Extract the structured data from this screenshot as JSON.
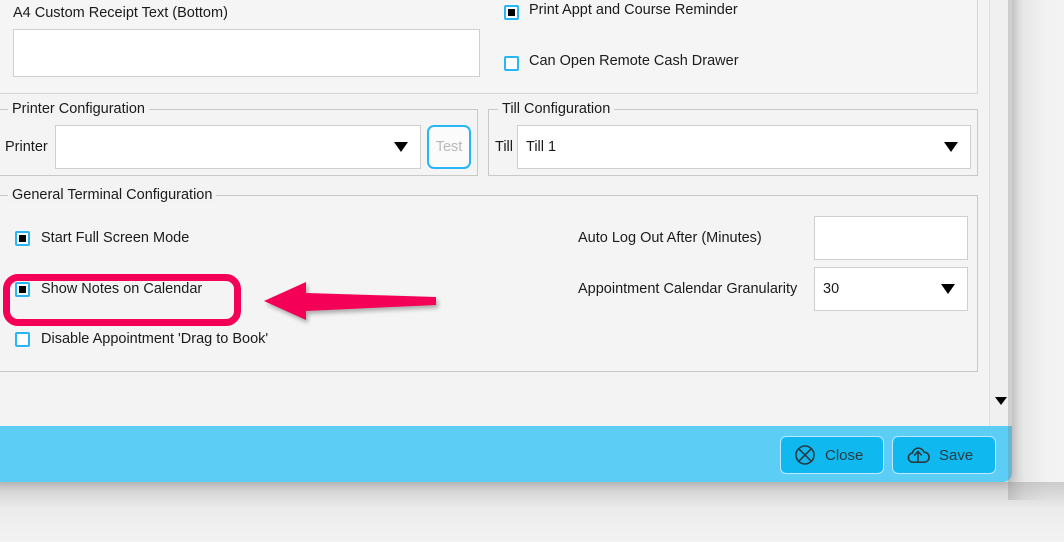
{
  "receipt_section": {
    "label": "A4 Custom Receipt Text (Bottom)",
    "textarea_value": "",
    "checkboxes": [
      {
        "label": "Print Appt and Course Reminder",
        "checked": true
      },
      {
        "label": "Can Open Remote Cash Drawer",
        "checked": false
      }
    ]
  },
  "printer_config": {
    "legend": "Printer Configuration",
    "printer_label": "Printer",
    "printer_value": "",
    "test_button_label": "Test"
  },
  "till_config": {
    "legend": "Till Configuration",
    "till_label": "Till",
    "till_value": "Till 1"
  },
  "general_terminal": {
    "legend": "General Terminal Configuration",
    "checkboxes": [
      {
        "label": "Start Full Screen Mode",
        "checked": true
      },
      {
        "label": "Show Notes on Calendar",
        "checked": true
      },
      {
        "label": "Disable Appointment 'Drag to Book'",
        "checked": false
      }
    ],
    "auto_logout_label": "Auto Log Out After (Minutes)",
    "auto_logout_value": "",
    "granularity_label": "Appointment Calendar Granularity",
    "granularity_value": "30"
  },
  "footer": {
    "close_label": "Close",
    "save_label": "Save"
  },
  "scrollbar": {
    "down_arrow_icon": "chevron-down-icon"
  },
  "annotation": {
    "highlight_target": "Show Notes on Calendar",
    "highlight_color": "#f50057",
    "arrow_color": "#f50057",
    "arrow_direction": "left"
  },
  "colors": {
    "accent_blue": "#29b6f6",
    "footer_blue": "#5ccdf5",
    "button_blue": "#0fb9f0",
    "panel_bg": "#f5f5f5",
    "dialog_bg": "#f3f3f3"
  }
}
